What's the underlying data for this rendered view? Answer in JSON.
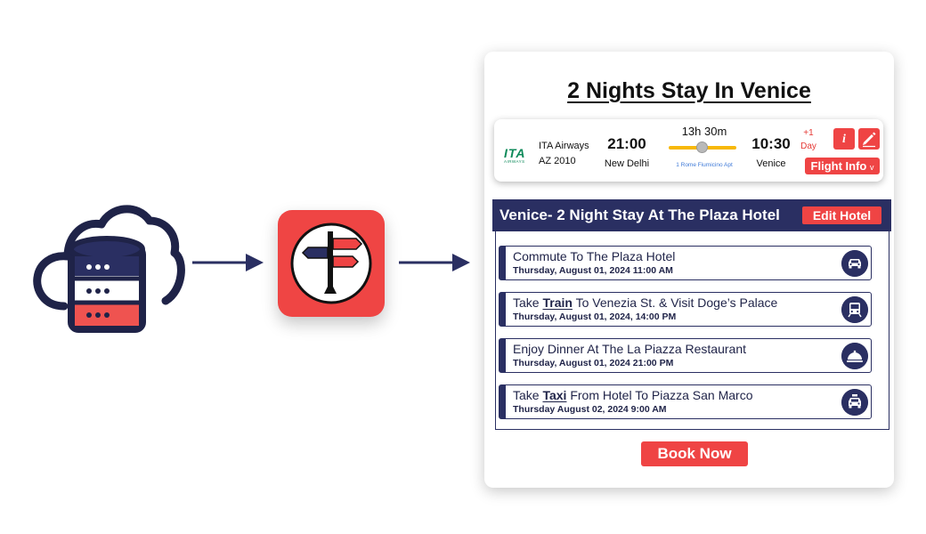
{
  "colors": {
    "navy": "#2a2f62",
    "accent_red": "#ef4444",
    "amber": "#f7b80a"
  },
  "diagram": {
    "source_icon": "cloud-database-icon",
    "app_icon": "signpost-app-icon",
    "arrow_icon": "right-arrow-icon"
  },
  "card": {
    "title": "2 Nights Stay In Venice",
    "flight": {
      "airline_logo_text": "ITA",
      "airline_logo_subtext": "AIRWAYS",
      "airline": "ITA Airways",
      "flight_number": "AZ 2010",
      "departure_time": "21:00",
      "departure_city": "New Delhi",
      "duration": "13h 30m",
      "stop": "1 Rome Fiumicino Apt",
      "arrival_time": "10:30",
      "arrival_city": "Venice",
      "day_offset_line1": "+1",
      "day_offset_line2": "Day",
      "info_button": "i",
      "edit_icon": "pencil-icon",
      "flight_info_label": "Flight Info",
      "flight_info_chevron": "v"
    },
    "hotel": {
      "title": "Venice- 2 Night Stay At The Plaza Hotel",
      "edit_label": "Edit Hotel",
      "activities": [
        {
          "pre": "Commute To The Plaza Hotel",
          "bold": "",
          "post": "",
          "date": "Thursday, August 01, 2024 11:00 AM",
          "icon": "car-icon"
        },
        {
          "pre": "Take ",
          "bold": "Train",
          "post": " To Venezia St. & Visit Doge’s Palace",
          "date": "Thursday, August 01, 2024, 14:00 PM",
          "icon": "train-icon"
        },
        {
          "pre": "Enjoy Dinner At The La Piazza Restaurant",
          "bold": "",
          "post": "",
          "date": "Thursday, August 01, 2024 21:00 PM",
          "icon": "food-cloche-icon"
        },
        {
          "pre": "Take ",
          "bold": "Taxi",
          "post": " From Hotel To Piazza San Marco",
          "date": "Thursday August 02, 2024 9:00 AM",
          "icon": "taxi-icon"
        }
      ]
    },
    "book_label": "Book Now"
  }
}
